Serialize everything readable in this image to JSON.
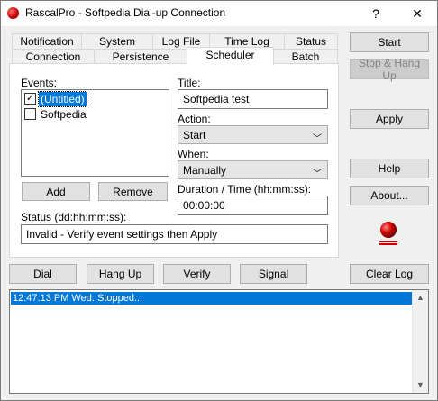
{
  "window": {
    "title": "RascalPro - Softpedia Dial-up Connection",
    "help_glyph": "?",
    "close_glyph": "✕"
  },
  "tabs_row1": [
    "Notification",
    "System",
    "Log File",
    "Time Log",
    "Status"
  ],
  "tabs_row2": [
    "Connection",
    "Persistence",
    "Scheduler",
    "Batch"
  ],
  "scheduler": {
    "events_label": "Events:",
    "events": [
      {
        "label": "(Untitled)",
        "checked": true
      },
      {
        "label": "Softpedia",
        "checked": false
      }
    ],
    "add_label": "Add",
    "remove_label": "Remove",
    "title_label": "Title:",
    "title_value": "Softpedia test",
    "action_label": "Action:",
    "action_value": "Start",
    "when_label": "When:",
    "when_value": "Manually",
    "duration_label": "Duration / Time (hh:mm:ss):",
    "duration_value": "00:00:00",
    "status_label": "Status (dd:hh:mm:ss):",
    "status_value": "Invalid - Verify event settings then Apply"
  },
  "right_buttons": {
    "start": "Start",
    "stop_hang_up": "Stop & Hang Up",
    "apply": "Apply",
    "help": "Help",
    "about": "About..."
  },
  "bottom_buttons": {
    "dial": "Dial",
    "hang_up": "Hang Up",
    "verify": "Verify",
    "signal": "Signal",
    "clear_log": "Clear Log"
  },
  "log": {
    "lines": [
      "12:47:13 PM Wed: Stopped..."
    ]
  },
  "colors": {
    "selection": "#0078d7",
    "button_face": "#e1e1e1",
    "window_bg": "#f0f0f0",
    "logo_red": "#cc0000"
  }
}
